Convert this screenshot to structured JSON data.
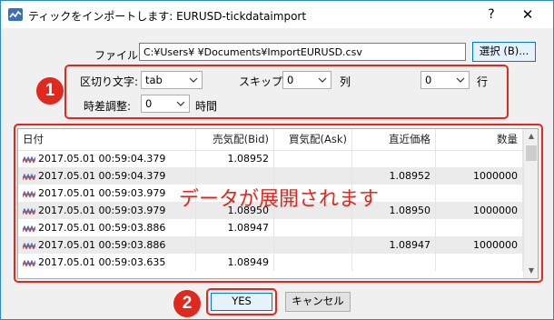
{
  "window": {
    "title": "ティックをインポートします: EURUSD-tickdataimport",
    "help": "?",
    "close": "✕",
    "accent_color": "#2b88d8"
  },
  "file": {
    "label": "ファイル:",
    "path": "C:¥Users¥      ¥Documents¥ImportEURUSD.csv",
    "browse_label": "選択 (B)..."
  },
  "options": {
    "delimiter_label": "区切り文字:",
    "delimiter_value": "tab",
    "skip_label": "スキップ:",
    "skip_value": "0",
    "column_label": "列",
    "row_value": "0",
    "row_label": "行",
    "timezone_label": "時差調整:",
    "timezone_value": "0",
    "hours_label": "時間"
  },
  "annotations": {
    "badge1": "1",
    "badge2": "2",
    "overlay_text": "データが展開されます",
    "highlight_color": "#e0281e"
  },
  "table": {
    "columns": [
      "日付",
      "売気配(Bid)",
      "買気配(Ask)",
      "直近価格",
      "数量"
    ],
    "rows": [
      [
        "2017.05.01 00:59:04.379",
        "1.08952",
        "",
        "",
        ""
      ],
      [
        "2017.05.01 00:59:04.379",
        "",
        "",
        "1.08952",
        "1000000"
      ],
      [
        "2017.05.01 00:59:03.979",
        "",
        "",
        "",
        ""
      ],
      [
        "2017.05.01 00:59:03.979",
        "1.08950",
        "",
        "1.08950",
        "1000000"
      ],
      [
        "2017.05.01 00:59:03.886",
        "1.08947",
        "",
        "",
        ""
      ],
      [
        "2017.05.01 00:59:03.886",
        "",
        "",
        "1.08947",
        "1000000"
      ],
      [
        "2017.05.01 00:59:03.635",
        "1.08949",
        "",
        "",
        ""
      ]
    ]
  },
  "buttons": {
    "yes": "YES",
    "cancel": "キャンセル"
  }
}
